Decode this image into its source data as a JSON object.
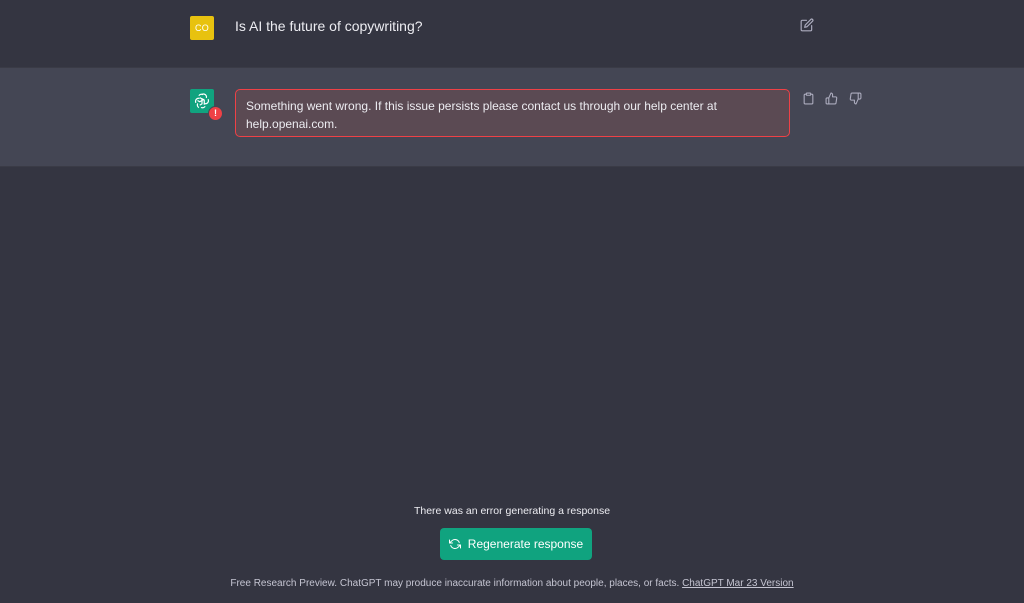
{
  "user_message": {
    "avatar_initials": "CO",
    "text": "Is AI the future of copywriting?",
    "edit_icon": "edit-icon",
    "avatar_color": "#e8c20f"
  },
  "assistant_message": {
    "avatar_icon": "openai-logo-icon",
    "error_badge": "!",
    "error_text": "Something went wrong. If this issue persists please contact us through our help center at help.openai.com.",
    "actions": [
      "copy-icon",
      "thumbs-up-icon",
      "thumbs-down-icon"
    ],
    "accent_color": "#10a37f",
    "error_color": "#ef4146"
  },
  "bottom": {
    "error_note": "There was an error generating a response",
    "regenerate_label": "Regenerate response",
    "regenerate_icon": "refresh-icon",
    "footer_text": "Free Research Preview. ChatGPT may produce inaccurate information about people, places, or facts.",
    "footer_link": "ChatGPT Mar 23 Version"
  }
}
